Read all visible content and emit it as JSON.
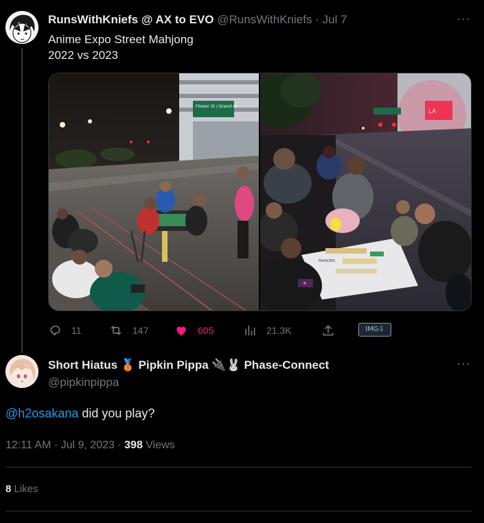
{
  "tweet": {
    "author_name": "RunsWithKniefs @ AX to EVO",
    "handle": "@RunsWithKniefs",
    "separator": "·",
    "date": "Jul 7",
    "text": "Anime Expo Street Mahjong\n2022 vs 2023",
    "media": {
      "left_sign_text": "Flower St / Grand Av",
      "right_sign_text": "LA",
      "right_board_text": "MAHJONG"
    },
    "actions": {
      "replies": "11",
      "retweets": "147",
      "likes": "605",
      "views": "21.3K",
      "img_badge": "IMG⇩"
    }
  },
  "reply": {
    "author_name": "Short Hiatus 🥉 Pipkin Pippa 🔌🐰 Phase-Connect",
    "handle": "@pipkinpippa",
    "mention": "@h2osakana",
    "text": " did you play?",
    "time": "12:11 AM · Jul 9, 2023 · ",
    "views_count": "398",
    "views_label": " Views",
    "likes_count": "8",
    "likes_label": " Likes"
  },
  "colors": {
    "background": "#000000",
    "text_primary": "#e7e9ea",
    "text_secondary": "#71767b",
    "like": "#f91880",
    "link": "#1d9bf0",
    "border": "#2f3336"
  }
}
